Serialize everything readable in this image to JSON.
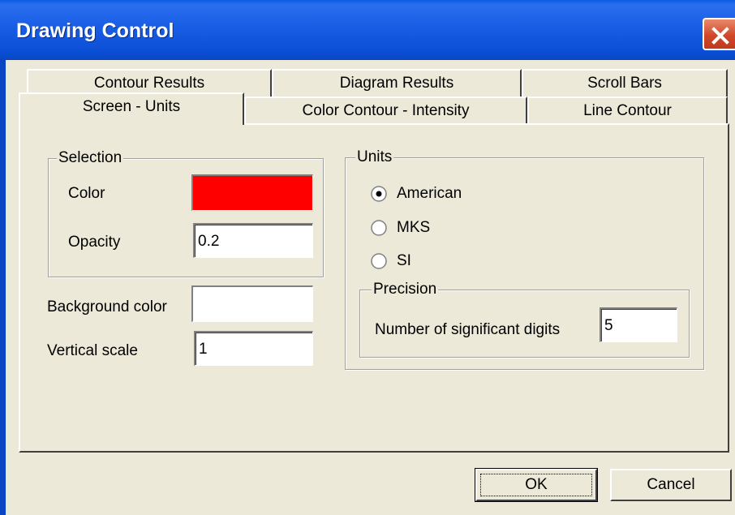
{
  "window": {
    "title": "Drawing Control"
  },
  "tabs": {
    "back_row": [
      "Contour Results",
      "Diagram Results",
      "Scroll Bars"
    ],
    "front_row": [
      "Screen - Units",
      "Color Contour - Intensity",
      "Line Contour"
    ],
    "active": "Screen - Units"
  },
  "selection": {
    "legend": "Selection",
    "color_label": "Color",
    "color_value": "#ff0000",
    "opacity_label": "Opacity",
    "opacity_value": "0.2"
  },
  "background": {
    "label": "Background color",
    "color_value": "#ffffff"
  },
  "vertical_scale": {
    "label": "Vertical scale",
    "value": "1"
  },
  "units": {
    "legend": "Units",
    "options": [
      "American",
      "MKS",
      "SI"
    ],
    "selected": "American"
  },
  "precision": {
    "legend": "Precision",
    "digits_label": "Number of significant digits",
    "digits_value": "5"
  },
  "buttons": {
    "ok": "OK",
    "cancel": "Cancel"
  }
}
